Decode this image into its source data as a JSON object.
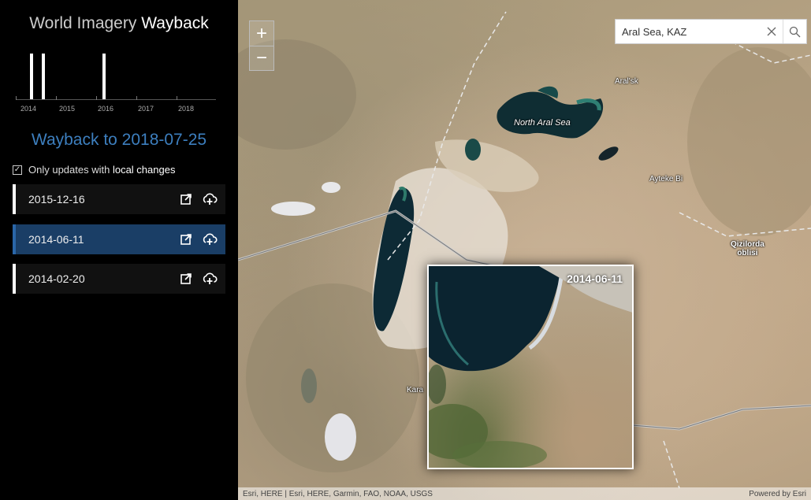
{
  "app": {
    "title_regular": "World Imagery ",
    "title_bold": "Wayback"
  },
  "timeline": {
    "years": [
      "2014",
      "2015",
      "2016",
      "2017",
      "2018"
    ]
  },
  "wayback_heading": "Wayback to 2018-07-25",
  "filter": {
    "text": "Only updates with ",
    "bold": "local changes",
    "checked": true
  },
  "releases": [
    {
      "date": "2015-12-16",
      "active": false
    },
    {
      "date": "2014-06-11",
      "active": true
    },
    {
      "date": "2014-02-20",
      "active": false
    }
  ],
  "search": {
    "value": "Aral Sea, KAZ"
  },
  "map": {
    "places": {
      "aralsk": "Aral'sk",
      "north_aral_sea": "North Aral Sea",
      "ayteke_bi": "Ayteke Bi",
      "qizilorda": "Qizilorda\noblisi",
      "kara": "Kara"
    },
    "swipe_label": "2014-06-11",
    "attribution_left": "Esri, HERE | Esri, HERE, Garmin, FAO, NOAA, USGS",
    "attribution_right": "Powered by Esri"
  },
  "colors": {
    "accent": "#3d7fbf",
    "active_item": "#1a3e66"
  }
}
